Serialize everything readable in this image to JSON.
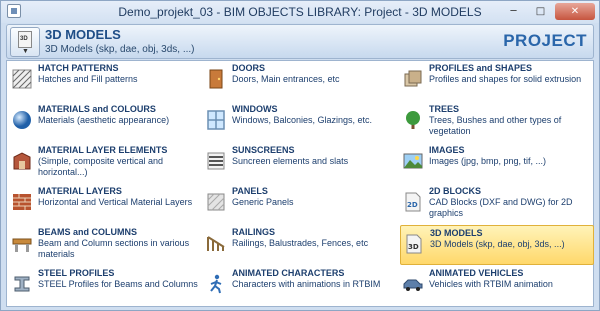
{
  "window": {
    "title": "Demo_projekt_03 -  BIM OBJECTS LIBRARY: Project - 3D MODELS"
  },
  "header": {
    "title": "3D MODELS",
    "subtitle": "3D Models (skp, dae, obj, 3ds, ...)",
    "scope": "PROJECT",
    "button_icon_text": "3D"
  },
  "items": [
    {
      "title": "HATCH PATTERNS",
      "desc": "Hatches and Fill patterns",
      "icon": "hatch-icon"
    },
    {
      "title": "DOORS",
      "desc": "Doors, Main entrances, etc",
      "icon": "door-icon"
    },
    {
      "title": "PROFILES and SHAPES",
      "desc": "Profiles and shapes for solid extrusion",
      "icon": "profile-icon"
    },
    {
      "title": "MATERIALS and COLOURS",
      "desc": "Materials (aesthetic appearance)",
      "icon": "sphere-icon"
    },
    {
      "title": "WINDOWS",
      "desc": "Windows, Balconies, Glazings, etc.",
      "icon": "window-icon"
    },
    {
      "title": "TREES",
      "desc": "Trees, Bushes and other types of vegetation",
      "icon": "tree-icon"
    },
    {
      "title": "MATERIAL LAYER ELEMENTS",
      "desc": "(Simple, composite vertical and horizontal...)",
      "icon": "layer-element-icon"
    },
    {
      "title": "SUNSCREENS",
      "desc": "Suncreen elements and slats",
      "icon": "sunscreen-icon"
    },
    {
      "title": "IMAGES",
      "desc": "Images (jpg, bmp, png, tif, ...)",
      "icon": "image-icon"
    },
    {
      "title": "MATERIAL LAYERS",
      "desc": "Horizontal and Vertical Material Layers",
      "icon": "brick-icon"
    },
    {
      "title": "PANELS",
      "desc": "Generic Panels",
      "icon": "panel-icon"
    },
    {
      "title": "2D BLOCKS",
      "desc": "CAD Blocks (DXF and DWG) for 2D graphics",
      "icon": "block-2d-icon"
    },
    {
      "title": "BEAMS and COLUMNS",
      "desc": "Beam and Column sections in various materials",
      "icon": "beam-icon"
    },
    {
      "title": "RAILINGS",
      "desc": "Railings, Balustrades, Fences, etc",
      "icon": "railing-icon"
    },
    {
      "title": "3D MODELS",
      "desc": "3D Models (skp, dae, obj, 3ds, ...)",
      "icon": "model-3d-icon"
    },
    {
      "title": "STEEL PROFILES",
      "desc": "STEEL Profiles for Beams and Columns",
      "icon": "steel-profile-icon"
    },
    {
      "title": "ANIMATED CHARACTERS",
      "desc": "Characters with animations in RTBIM",
      "icon": "character-icon"
    },
    {
      "title": "ANIMATED VEHICLES",
      "desc": "Vehicles with RTBIM animation",
      "icon": "vehicle-icon"
    }
  ],
  "selected_index": 14
}
